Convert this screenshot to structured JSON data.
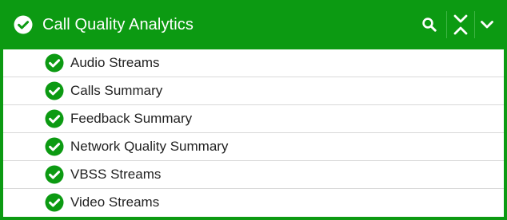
{
  "panel": {
    "title": "Call Quality Analytics",
    "accent_color": "#0c9a12",
    "header_icon": "check-circle-icon",
    "tools": [
      "search-icon",
      "collapse-all-icon",
      "chevron-down-icon"
    ]
  },
  "items": [
    {
      "label": "Audio Streams",
      "icon": "check-circle-icon"
    },
    {
      "label": "Calls Summary",
      "icon": "check-circle-icon"
    },
    {
      "label": "Feedback Summary",
      "icon": "check-circle-icon"
    },
    {
      "label": "Network Quality Summary",
      "icon": "check-circle-icon"
    },
    {
      "label": "VBSS Streams",
      "icon": "check-circle-icon"
    },
    {
      "label": "Video Streams",
      "icon": "check-circle-icon"
    }
  ]
}
